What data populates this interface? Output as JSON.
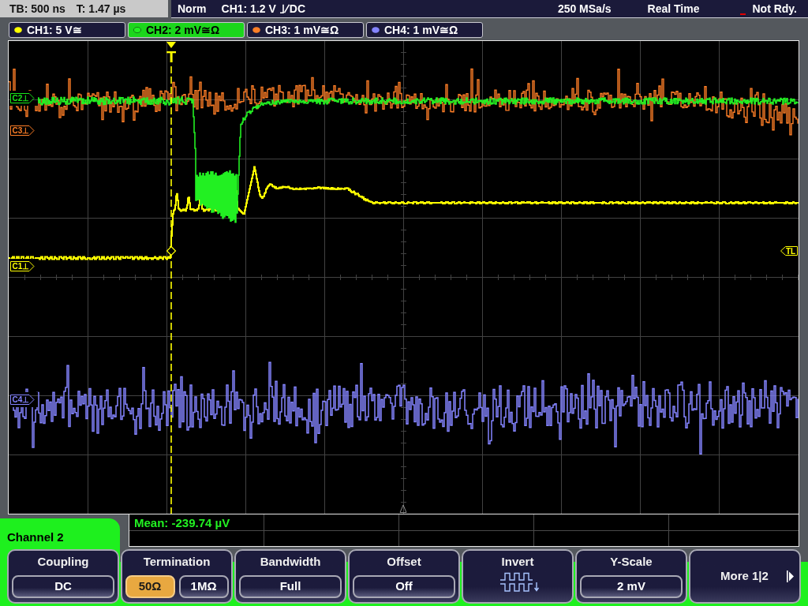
{
  "status_bar": {
    "timebase": "TB: 500 ns",
    "trigger_time": "T: 1.47 µs",
    "trigger_mode": "Norm",
    "trigger_level": "CH1: 1.2 V",
    "trigger_coupling": "DC",
    "sample_rate": "250 MSa/s",
    "acquisition_mode": "Real Time",
    "acquisition_status": "Not Rdy."
  },
  "channel_tabs": [
    {
      "label": "CH1: 5 V≅",
      "color": "#ffff00",
      "selected": false
    },
    {
      "label": "CH2: 2 mV≅Ω",
      "color": "#22f022",
      "selected": true
    },
    {
      "label": "CH3: 1 mV≅Ω",
      "color": "#ff7f27",
      "selected": false
    },
    {
      "label": "CH4: 1 mV≅Ω",
      "color": "#8484ff",
      "selected": false
    }
  ],
  "graticule": {
    "trigger_marker": "T",
    "channel_markers": [
      {
        "label": "C2⊥",
        "color": "#19e619"
      },
      {
        "label": "C3⊥",
        "color": "#ff7f27"
      },
      {
        "label": "C1⊥",
        "color": "#ffff00"
      },
      {
        "label": "C4⊥",
        "color": "#8484ff"
      }
    ],
    "trigger_level_marker": "TL"
  },
  "measurements": [
    {
      "text": "Mean: -239.74 µV"
    }
  ],
  "menu": {
    "title": "Channel 2",
    "buttons": [
      {
        "kind": "value",
        "title": "Coupling",
        "value": "DC"
      },
      {
        "kind": "choice",
        "title": "Termination",
        "options": [
          {
            "label": "50Ω",
            "selected": true
          },
          {
            "label": "1MΩ",
            "selected": false
          }
        ]
      },
      {
        "kind": "value",
        "title": "Bandwidth",
        "value": "Full"
      },
      {
        "kind": "value",
        "title": "Offset",
        "value": "Off"
      },
      {
        "kind": "icon",
        "title": "Invert"
      },
      {
        "kind": "value",
        "title": "Y-Scale",
        "value": "2 mV"
      },
      {
        "kind": "page",
        "title": "More 1|2"
      }
    ]
  }
}
